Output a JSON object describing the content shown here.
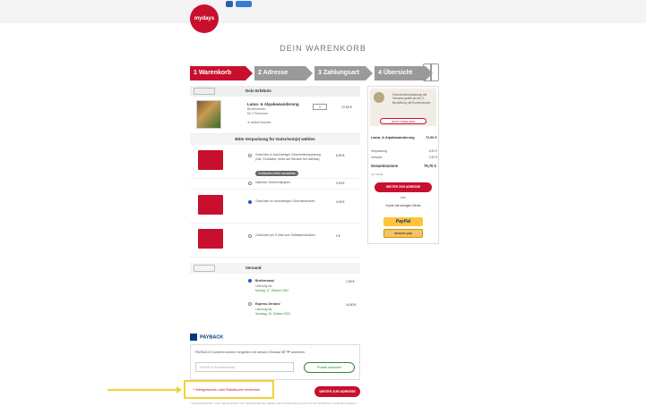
{
  "brand": {
    "logo_text": "mydays",
    "accent": "#c8102e",
    "step_inactive": "#9a9a9a",
    "highlight": "#f2d23a"
  },
  "page_title": "DEIN WARENKORB",
  "steps": [
    {
      "label": "1 Warenkorb"
    },
    {
      "label": "2 Adresse"
    },
    {
      "label": "3 Zahlungsart"
    },
    {
      "label": "4 Übersicht"
    }
  ],
  "experience": {
    "section_label": "Dein Erlebnis",
    "product_title": "Lama- & Alpakawanderung",
    "product_location": "Bruchhausen",
    "product_people": "für 2 Personen",
    "remove_label": "Artikel löschen",
    "quantity": "1",
    "price": "72,90 €"
  },
  "packaging": {
    "heading": "Bitte Verpackung für Gutschein(e) wählen",
    "options": [
      {
        "text": "Gutschein in hochwertiger Geschenkverpackung (inkl. Grußkarte, Motiv auf Wunsch frei wählbar)",
        "price": "6,90 €",
        "button": "Grußkarten-Motiv auswählen"
      },
      {
        "text": "Inklusive Geschenkpapier",
        "price": "3,00 €"
      },
      {
        "text": "Gutschein im hochwertigen Geschenkkuvert",
        "price": "4,90 €"
      },
      {
        "text": "Gutschein per E-Mail zum Selbstausdrucken",
        "price": "0 €"
      }
    ]
  },
  "shipping": {
    "heading": "Versand",
    "options": [
      {
        "name": "Briefversand",
        "sub": "Lieferung bis:",
        "date": "Montag, 17. Oktober 2022",
        "price": "1,90 €"
      },
      {
        "name": "Express-Versand",
        "sub": "Lieferung bis:",
        "date": "Samstag, 15. Oktober 2022",
        "price": "14,90 €"
      }
    ]
  },
  "payback": {
    "logo_text": "PAYBACK",
    "prompt_prefix": "PAYBACK Kundennummer eingeben mit diesem Einkauf ",
    "points": "37 °P",
    "prompt_suffix": " sammeln.",
    "input_placeholder": "PAYBACK Kundennummer",
    "button_label": "Punkte sammeln"
  },
  "voucher_link": "+ Wertgutschein oder Rabattcode einreichen",
  "next_button": "WEITER ZUR ADRESSE",
  "footnote": "* Versandkostenfrei, wenn Sie Gutschein zum Selbstausdrucken wählen oder die Bestellung nicht mehr als 10 Wochen vorhanden/ gültig ist",
  "sidebar": {
    "gift_text": "Geschenkverpackung mit Versand gratis ab der 2. Bestellung mit Kundenkonto.",
    "gift_button": "JETZT ANMELDEN",
    "item_title": "Lama- & Alpakawanderung",
    "item_price": "72,90 €",
    "rows": [
      {
        "label": "Verpackung",
        "value": "4,90 €"
      },
      {
        "label": "Versand",
        "value": "1,90 €"
      }
    ],
    "total_label": "Gesamtsumme",
    "total_value": "79,70 €",
    "vat_note": "inkl. MwSt.",
    "checkout_button": "WEITER ZUR ADRESSE",
    "or_label": "oder",
    "quick_label": "Kaufe mit wenigen Klicks",
    "paypal_label": "PayPal",
    "amazon_label": "amazon pay"
  }
}
